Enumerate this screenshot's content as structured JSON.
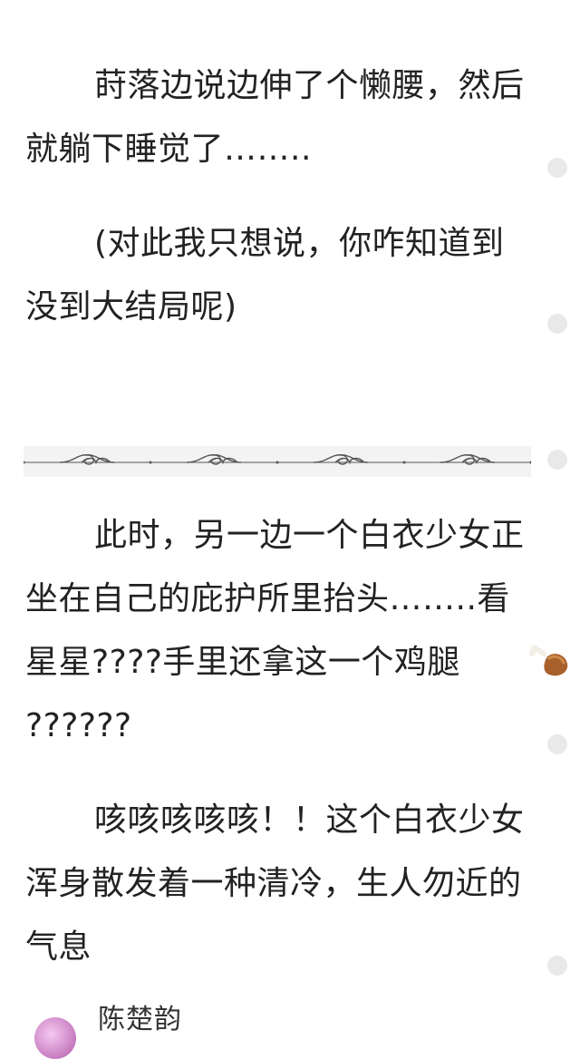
{
  "paragraphs": [
    {
      "text": "莳落边说边伸了个懒腰，然后就躺下睡觉了……..",
      "indent": true
    },
    {
      "text": "(对此我只想说，你咋知道到没到大结局呢)",
      "indent": true
    },
    {
      "text": "此时，另一边一个白衣少女正坐在自己的庇护所里抬头……..看星星????手里还拿这一个鸡腿",
      "after_emoji": "??????",
      "indent": true
    },
    {
      "text": "咳咳咳咳咳！！这个白衣少女浑身散发着一种清冷，生人勿近的气息",
      "indent": true
    }
  ],
  "emoji": {
    "name": "drumstick-icon"
  },
  "divider": {
    "name": "ornamental-divider"
  },
  "user": {
    "name": "陈楚韵"
  },
  "colors": {
    "text": "#222222",
    "dot": "#e9e9e9",
    "divider_bg": "#f3f3f3",
    "divider_line": "#555555"
  }
}
